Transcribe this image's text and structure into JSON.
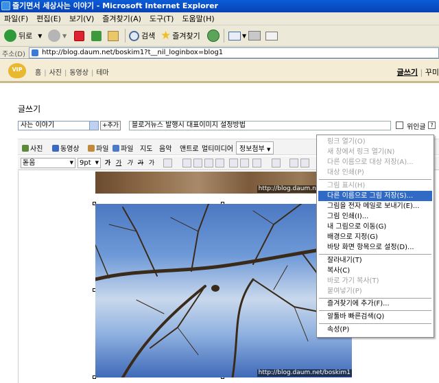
{
  "window": {
    "title": "즐기면서 세상사는 이야기 - Microsoft Internet Explorer"
  },
  "menu": [
    "파일(F)",
    "편집(E)",
    "보기(V)",
    "즐겨찾기(A)",
    "도구(T)",
    "도움말(H)"
  ],
  "toolbar": {
    "back_label": "뒤로",
    "search_label": "검색",
    "favorites_label": "즐겨찾기"
  },
  "address": {
    "label": "주소(D)",
    "url": "http://blog.daum.net/boskim1?t__nil_loginbox=blog1"
  },
  "blog_nav": {
    "vip": "VIP",
    "items": [
      "홈",
      "사진",
      "동영상",
      "테마"
    ],
    "write": "글쓰기",
    "more": "꾸미"
  },
  "editor": {
    "page_title": "글쓰기",
    "category": "사는 이야기",
    "add_button": "+추가",
    "post_title": "블로거뉴스 발행시 대표이미지 설정방법",
    "checkbox_label": "위인글",
    "help": "?",
    "toolbar1": [
      "사진",
      "동영상",
      "파일",
      "파일",
      "지도",
      "음악",
      "앤트로",
      "멀티미디어",
      "정보첨부"
    ],
    "font": "돋움",
    "size": "9pt",
    "format_buttons": [
      "가",
      "가",
      "가",
      "가",
      "가"
    ]
  },
  "watermark": "http://blog.daum.net/boskim1",
  "context_menu": {
    "items": [
      {
        "label": "링크 열기(O)",
        "state": "disabled"
      },
      {
        "label": "새 창에서 링크 열기(N)",
        "state": "disabled"
      },
      {
        "label": "다른 이름으로 대상 저장(A)...",
        "state": "disabled"
      },
      {
        "label": "대상 인쇄(P)",
        "state": "disabled"
      },
      {
        "label": "그림 표시(H)",
        "state": "disabled"
      },
      {
        "label": "다른 이름으로 그림 저장(S)...",
        "state": "selected"
      },
      {
        "label": "그림을 전자 메일로 보내기(E)...",
        "state": "normal"
      },
      {
        "label": "그림 인쇄(I)...",
        "state": "normal"
      },
      {
        "label": "내 그림으로 이동(G)",
        "state": "normal"
      },
      {
        "label": "배경으로 지정(G)",
        "state": "normal"
      },
      {
        "label": "바탕 화면 항목으로 설정(D)...",
        "state": "normal"
      },
      {
        "label": "잘라내기(T)",
        "state": "normal"
      },
      {
        "label": "복사(C)",
        "state": "normal"
      },
      {
        "label": "바로 가기 복사(T)",
        "state": "disabled"
      },
      {
        "label": "붙여넣기(P)",
        "state": "disabled"
      },
      {
        "label": "즐겨찾기에 추가(F)...",
        "state": "normal"
      },
      {
        "label": "알툴바 빠른검색(Q)",
        "state": "normal"
      },
      {
        "label": "속성(P)",
        "state": "normal"
      }
    ]
  }
}
